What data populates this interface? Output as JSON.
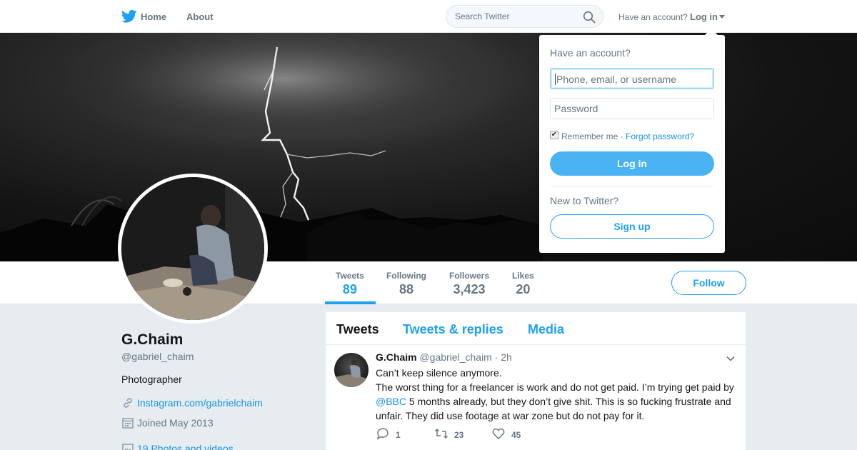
{
  "nav": {
    "home_label": "Home",
    "about_label": "About",
    "search_placeholder": "Search Twitter",
    "have_account": "Have an account?",
    "login_label": "Log in",
    "brand_color": "#1da1f2"
  },
  "login_dropdown": {
    "title": "Have an account?",
    "username_placeholder": "Phone, email, or username",
    "password_placeholder": "Password",
    "remember_me": "Remember me",
    "separator": "·",
    "forgot_password": "Forgot password?",
    "remember_checked": true,
    "login_button": "Log in",
    "new_to_twitter": "New to Twitter?",
    "signup_button": "Sign up"
  },
  "profile": {
    "name": "G.Chaim",
    "handle": "@gabriel_chaim",
    "bio": "Photographer",
    "website": "Instagram.com/gabrielchaim",
    "joined": "Joined May 2013",
    "photos": "19 Photos and videos"
  },
  "stats": [
    {
      "label": "Tweets",
      "value": "89",
      "active": true
    },
    {
      "label": "Following",
      "value": "88",
      "active": false
    },
    {
      "label": "Followers",
      "value": "3,423",
      "active": false
    },
    {
      "label": "Likes",
      "value": "20",
      "active": false
    }
  ],
  "follow_button": "Follow",
  "timeline": {
    "tabs": [
      "Tweets",
      "Tweets & replies",
      "Media"
    ],
    "tweet": {
      "name": "G.Chaim",
      "handle": "@gabriel_chaim",
      "time": "· 2h",
      "line1": "Can’t keep silence anymore.",
      "line2": "The worst thing for a freelancer is work and do not get paid. I’m trying get paid by",
      "mention": "@BBC",
      "line3": " 5 months already, but they don’t give shit. This is so fucking  frustrate and unfair. They did use footage at war zone but do not pay for it.",
      "replies": "1",
      "retweets": "23",
      "likes": "45"
    }
  }
}
